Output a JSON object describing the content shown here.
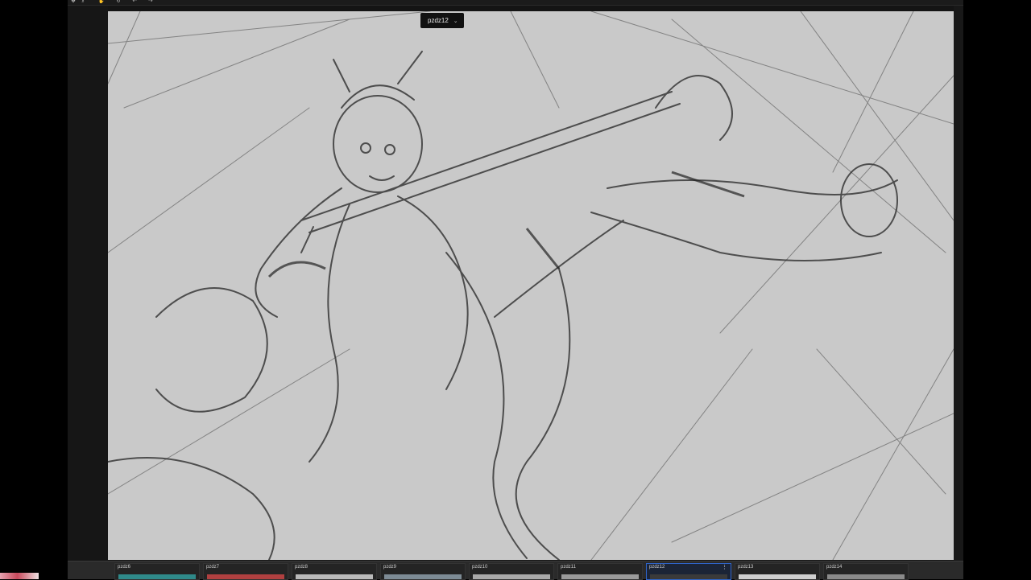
{
  "toolbar": {
    "icons": [
      "move-tool-icon",
      "zoom-tool-icon",
      "hand-tool-icon",
      "rotate-tool-icon",
      "undo-icon",
      "redo-icon"
    ]
  },
  "document": {
    "active_tab_label": "pzdz12",
    "tab_chevron": "⌄"
  },
  "filmstrip": {
    "items": [
      {
        "label": "pzdz6",
        "color": "#2f8a8a"
      },
      {
        "label": "pzdz7",
        "color": "#b04040"
      },
      {
        "label": "pzdz8",
        "color": "#b9b9b9"
      },
      {
        "label": "pzdz9",
        "color": "#7d8b95"
      },
      {
        "label": "pzdz10",
        "color": "#a9a9a9"
      },
      {
        "label": "pzdz11",
        "color": "#9a9a9a"
      },
      {
        "label": "pzdz12",
        "color": "#3a3a3a",
        "active": true,
        "menu": "⋮"
      },
      {
        "label": "pzdz13",
        "color": "#cfcfcf"
      },
      {
        "label": "pzdz14",
        "color": "#8a8a8a"
      }
    ]
  },
  "colors": {
    "canvas_bg": "#c9c9c9",
    "active_border": "#2f64c8"
  }
}
